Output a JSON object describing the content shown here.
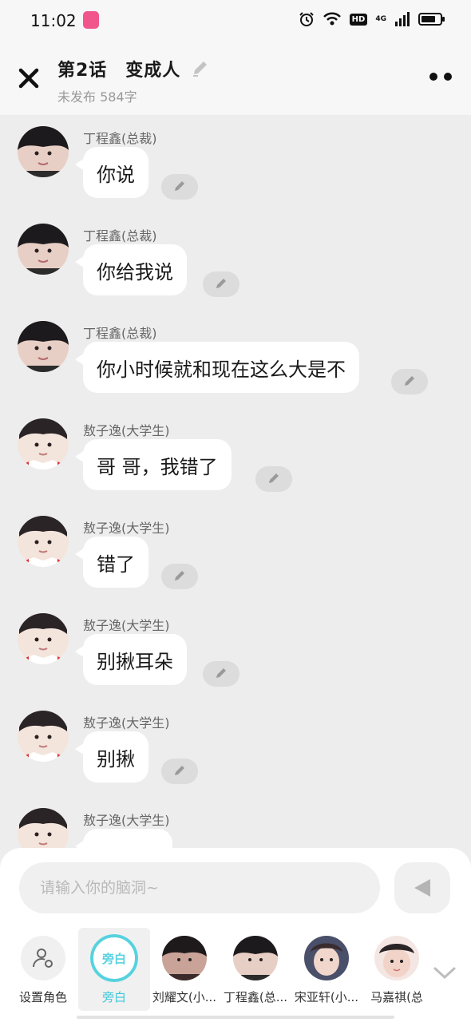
{
  "status": {
    "time": "11:02",
    "hd": "HD",
    "network": "4G"
  },
  "header": {
    "title": "第2话　变成人",
    "subtitle": "未发布 584字"
  },
  "messages": [
    {
      "speaker": "丁程鑫(总裁)",
      "text": "你说",
      "avatar": "dcx"
    },
    {
      "speaker": "丁程鑫(总裁)",
      "text": "你给我说",
      "avatar": "dcx"
    },
    {
      "speaker": "丁程鑫(总裁)",
      "text": "你小时候就和现在这么大是不",
      "avatar": "dcx"
    },
    {
      "speaker": "敖子逸(大学生)",
      "text": "哥 哥，我错了",
      "avatar": "azy"
    },
    {
      "speaker": "敖子逸(大学生)",
      "text": "错了",
      "avatar": "azy"
    },
    {
      "speaker": "敖子逸(大学生)",
      "text": "别揪耳朵",
      "avatar": "azy"
    },
    {
      "speaker": "敖子逸(大学生)",
      "text": "别揪",
      "avatar": "azy"
    },
    {
      "speaker": "敖子逸(大学生)",
      "text": "",
      "avatar": "azy"
    }
  ],
  "composer": {
    "placeholder": "请输入你的脑洞~",
    "value": ""
  },
  "roles": [
    {
      "label": "设置角色",
      "icon": "person-settings-icon"
    },
    {
      "label": "旁白",
      "badge": "旁白",
      "active": true
    },
    {
      "label": "刘耀文(小..."
    },
    {
      "label": "丁程鑫(总..."
    },
    {
      "label": "宋亚轩(小..."
    },
    {
      "label": "马嘉祺(总"
    }
  ],
  "colors": {
    "accent": "#56d2de",
    "background": "#ededed",
    "bubble": "#ffffff"
  }
}
